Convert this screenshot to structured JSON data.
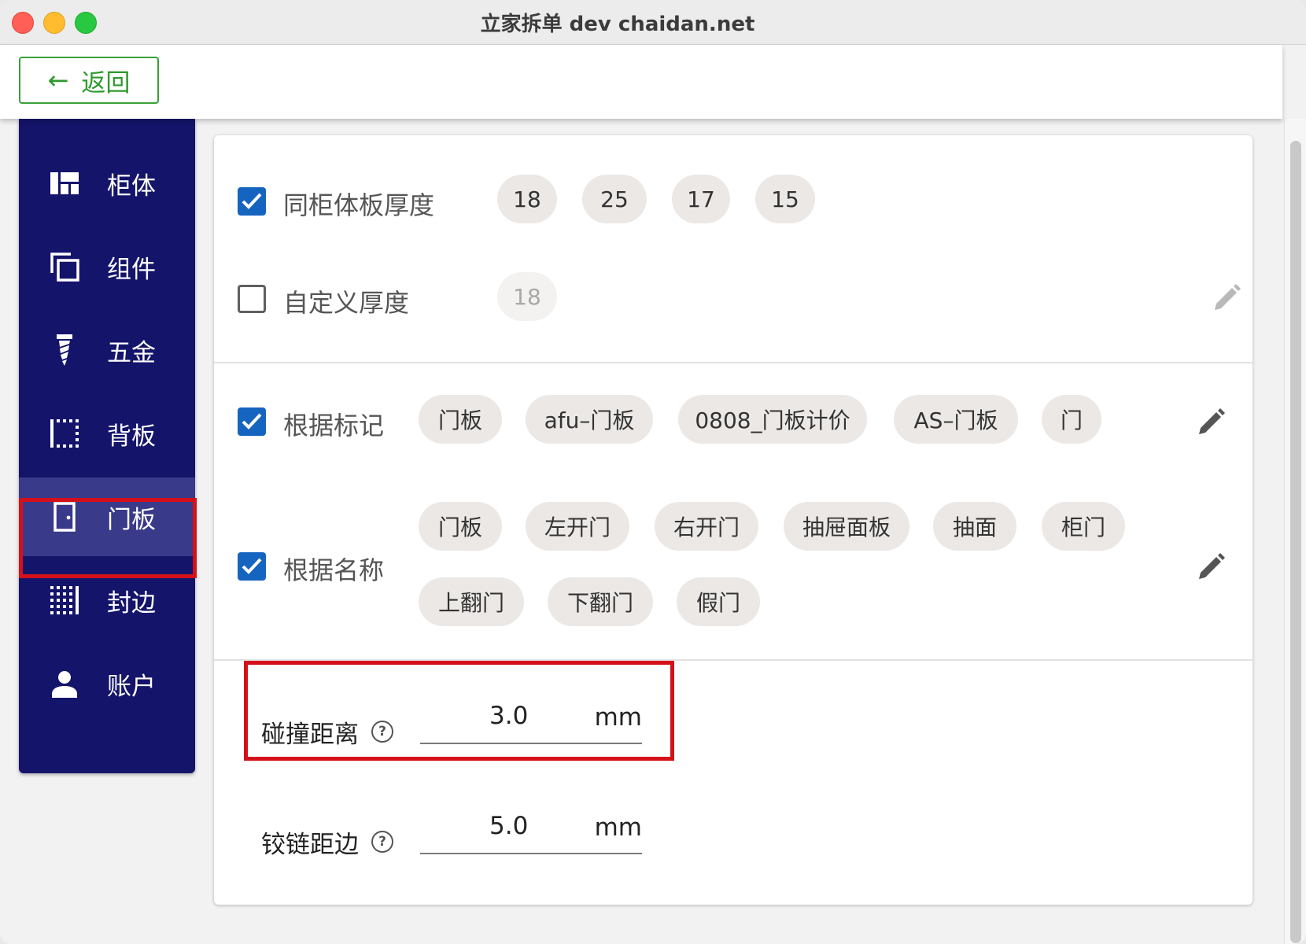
{
  "window": {
    "title": "立家拆单 dev  chaidan.net"
  },
  "toolbar": {
    "back_label": "返回"
  },
  "sidebar": {
    "items": [
      {
        "label": "柜体",
        "icon": "dashboard-icon"
      },
      {
        "label": "组件",
        "icon": "copy-icon"
      },
      {
        "label": "五金",
        "icon": "screw-icon"
      },
      {
        "label": "背板",
        "icon": "dotted-border-icon"
      },
      {
        "label": "门板",
        "icon": "door-icon",
        "active": true
      },
      {
        "label": "封边",
        "icon": "grid-border-icon"
      },
      {
        "label": "账户",
        "icon": "person-icon"
      }
    ]
  },
  "thickness": {
    "same_label": "同柜体板厚度",
    "same_checked": true,
    "same_chips": [
      "18",
      "25",
      "17",
      "15"
    ],
    "custom_label": "自定义厚度",
    "custom_checked": false,
    "custom_chips": [
      "18"
    ]
  },
  "by_mark": {
    "label": "根据标记",
    "checked": true,
    "chips": [
      "门板",
      "afu–门板",
      "0808_门板计价",
      "AS–门板",
      "门"
    ]
  },
  "by_name": {
    "label": "根据名称",
    "checked": true,
    "chips": [
      "门板",
      "左开门",
      "右开门",
      "抽屉面板",
      "抽面",
      "柜门",
      "上翻门",
      "下翻门",
      "假门"
    ]
  },
  "fields": {
    "collision": {
      "label": "碰撞距离",
      "value": "3.0",
      "unit": "mm"
    },
    "hinge": {
      "label": "铰链距边",
      "value": "5.0",
      "unit": "mm"
    }
  },
  "colors": {
    "sidebar_bg": "#14146b",
    "accent_blue": "#1565c0",
    "back_green": "#2e9a2e",
    "highlight_red": "#d4101a"
  }
}
